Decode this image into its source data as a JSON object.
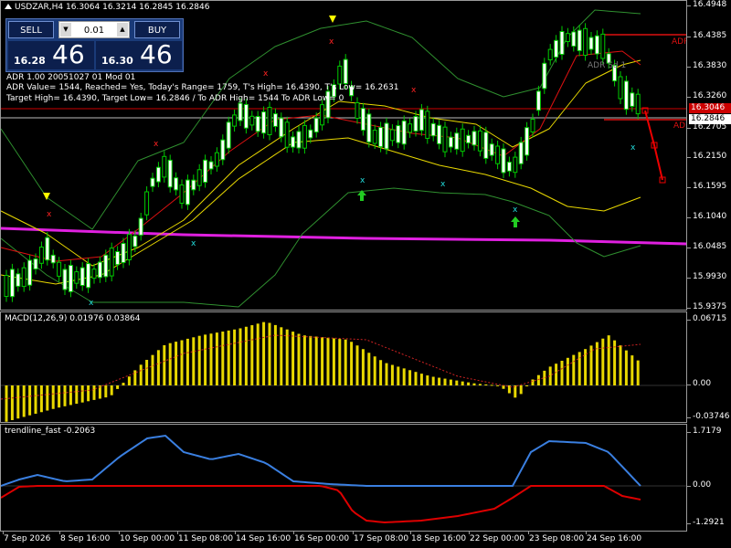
{
  "header": {
    "symbol_line": "USDZAR,H4  16.3064 16.3214 16.2845 16.2846"
  },
  "trade_panel": {
    "sell_label": "SELL",
    "buy_label": "BUY",
    "quantity": "0.01",
    "sell_price_small": "16.28",
    "sell_price_big": "46",
    "buy_price_small": "16.30",
    "buy_price_big": "46"
  },
  "info_lines": [
    "ADR 1.00 20051027 01 Mod 01",
    "ADR Value= 1544, Reached= Yes, Today's Range= 1759, T's High= 16.4390, T's Low= 16.2631",
    "Target High= 16.4390, Target Low= 16.2846 / To ADR High= 1544 To ADR Low= 0"
  ],
  "chart_labels": {
    "adr_top": "ADR",
    "adr_bottom": "ADR",
    "adr_side": "ADR Sd 1"
  },
  "price_axis": {
    "labels": [
      "16.4948",
      "16.4385",
      "16.3830",
      "16.3260",
      "16.2705",
      "16.2150",
      "16.1595",
      "16.1040",
      "16.0485",
      "15.9930",
      "15.9375"
    ],
    "ask_box": "16.3046",
    "bid_box": "16.2846",
    "ask_color": "#cc0000",
    "bid_color": "#ffffff"
  },
  "macd": {
    "title": "MACD(12,26,9) 0.01976 0.03864",
    "axis_labels": [
      "0.06715",
      "0.00",
      "-0.03746"
    ],
    "histogram_color": "#ffff00",
    "signal_color": "#cc0000"
  },
  "trendline": {
    "title": "trendline_fast -0.2063",
    "axis_labels": [
      "1.7179",
      "0.00",
      "-1.2921"
    ],
    "fast_color": "#3a7fe0",
    "slow_color": "#dd0000"
  },
  "time_axis": [
    "7 Sep 2026",
    "8 Sep 16:00",
    "10 Sep 00:00",
    "11 Sep 08:00",
    "14 Sep 16:00",
    "16 Sep 00:00",
    "17 Sep 08:00",
    "18 Sep 16:00",
    "22 Sep 00:00",
    "23 Sep 08:00",
    "24 Sep 16:00"
  ],
  "colors": {
    "bull_candle": "#ffffff",
    "bear_candle": "#000000",
    "candle_outline": "#00cc00",
    "trendline_magenta": "#e020e0",
    "bollinger_green": "#2f8f2f",
    "ma_yellow": "#e8d800",
    "ma_red": "#dd1111"
  }
}
